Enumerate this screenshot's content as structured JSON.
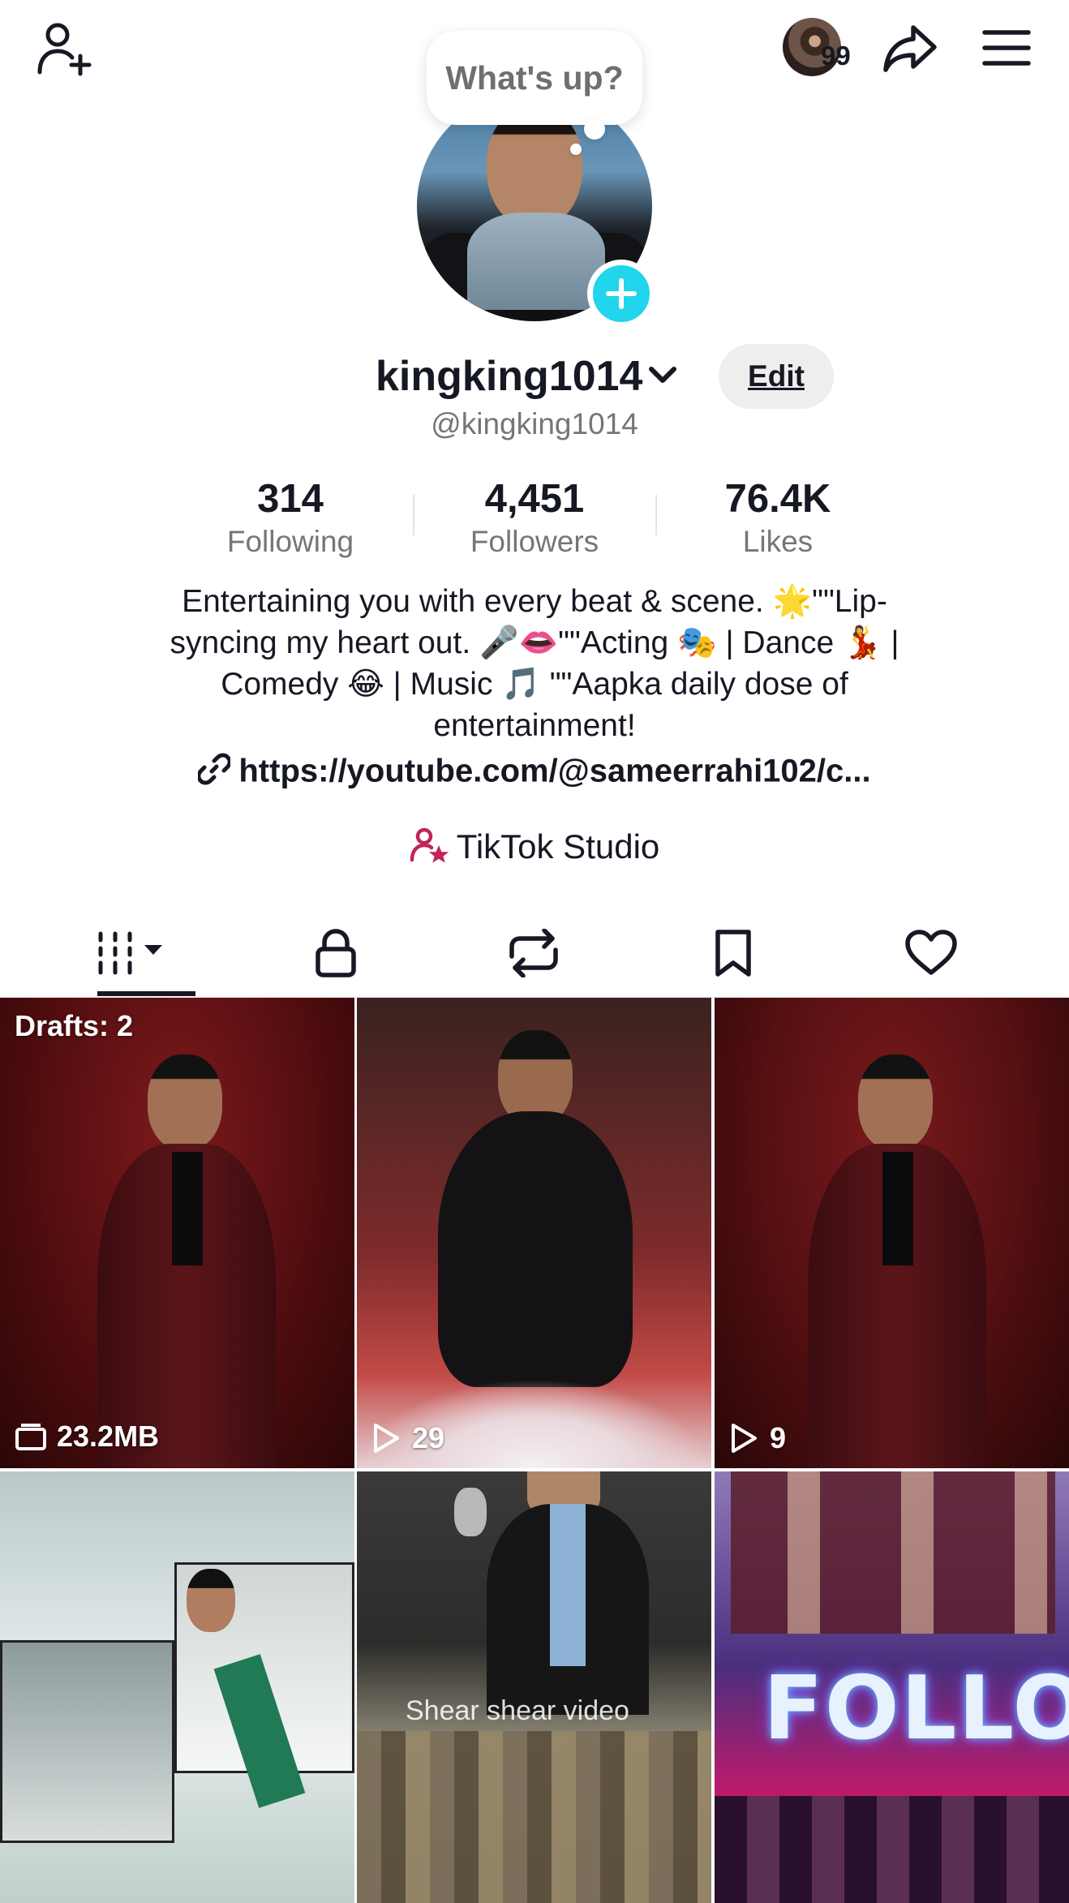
{
  "top_bar": {
    "add_friend_icon": "person-plus-icon",
    "notification_count": "99",
    "share_icon": "share-arrow-icon",
    "menu_icon": "hamburger-menu-icon"
  },
  "bubble": {
    "text": "What's up?"
  },
  "profile": {
    "username": "kingking1014",
    "handle": "@kingking1014",
    "edit_label": "Edit",
    "stats": [
      {
        "value": "314",
        "label": "Following"
      },
      {
        "value": "4,451",
        "label": "Followers"
      },
      {
        "value": "76.4K",
        "label": "Likes"
      }
    ],
    "bio_lines": [
      "Entertaining you with every beat & scene. 🌟\"\"Lip-",
      "syncing my heart out. 🎤👄\"\"Acting 🎭 | Dance 💃 |",
      "Comedy 😂 | Music 🎵 \"\"Aapka daily dose of",
      "entertainment!"
    ],
    "link": "https://youtube.com/@sameerrahi102/c...",
    "studio_label": "TikTok Studio"
  },
  "tabs": [
    {
      "name": "videos-grid",
      "icon": "grid-icon",
      "active": true
    },
    {
      "name": "private",
      "icon": "lock-icon"
    },
    {
      "name": "reposts",
      "icon": "repost-icon"
    },
    {
      "name": "favorites",
      "icon": "bookmark-icon"
    },
    {
      "name": "liked",
      "icon": "heart-icon"
    }
  ],
  "grid": [
    {
      "label": "Drafts: 2",
      "meta": "23.2MB",
      "meta_icon": "drafts-box-icon"
    },
    {
      "meta": "29",
      "meta_icon": "play-icon"
    },
    {
      "meta": "9",
      "meta_icon": "play-icon"
    },
    {
      "meta": ""
    },
    {
      "caption": "Shear shear video"
    },
    {
      "overlay_text": "FOLLOW"
    }
  ],
  "colors": {
    "accent_cyan": "#20d5ec",
    "studio_icon": "#c0245a",
    "text_primary": "#161823",
    "text_secondary": "#75757a"
  }
}
